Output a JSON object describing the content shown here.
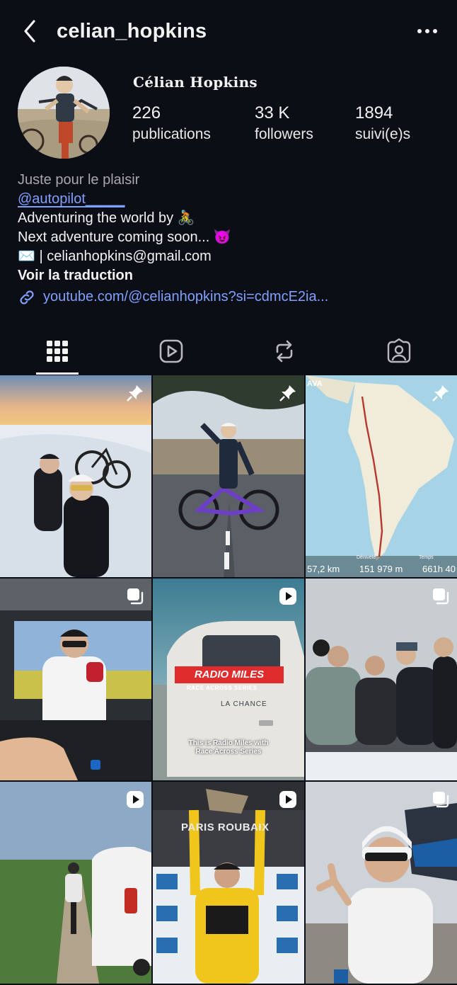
{
  "header": {
    "username": "celian_hopkins",
    "back_icon": "chevron-left-icon",
    "more_icon": "more-horizontal-icon"
  },
  "profile": {
    "display_name": "Célian Hopkins",
    "stats": [
      {
        "value": "226",
        "label": "publications"
      },
      {
        "value": "33 K",
        "label": "followers"
      },
      {
        "value": "1894",
        "label": "suivi(e)s"
      }
    ]
  },
  "bio": {
    "category": "Juste pour le plaisir",
    "mention": "@autopilot_____",
    "line1": "Adventuring the world by 🚴",
    "line2": "Next adventure coming soon... 😈",
    "line3": "✉️ | celianhopkins@gmail.com",
    "translate": "Voir la traduction",
    "link": "youtube.com/@celianhopkins?si=cdmcE2ia..."
  },
  "tabs": [
    "grid-icon",
    "reels-icon",
    "reposts-icon",
    "tagged-icon"
  ],
  "posts": [
    {
      "badge": "pin-icon"
    },
    {
      "badge": "pin-icon"
    },
    {
      "badge": "pin-icon",
      "map_brand": "AVA",
      "distance": "57,2 km",
      "elevation": "151 979 m",
      "time": "661h 40",
      "elevation_label": "Dénivelé",
      "time_label": "Temps"
    },
    {
      "badge": "carousel-icon"
    },
    {
      "badge": "reel-icon",
      "title": "RADIO MILES",
      "subtitle": "RACE ACROSS SERIES",
      "caption1": "This is Radio Miles with",
      "caption2": "Race Across Series",
      "door_text": "LA CHANCE"
    },
    {
      "badge": "carousel-icon"
    },
    {
      "badge": "reel-icon"
    },
    {
      "badge": "reel-icon",
      "banner": "PARIS ROUBAIX"
    },
    {
      "badge": "carousel-icon"
    }
  ],
  "colors": {
    "background": "#0c0e15",
    "link": "#7fa0ff",
    "muted": "#a6a8ad"
  }
}
